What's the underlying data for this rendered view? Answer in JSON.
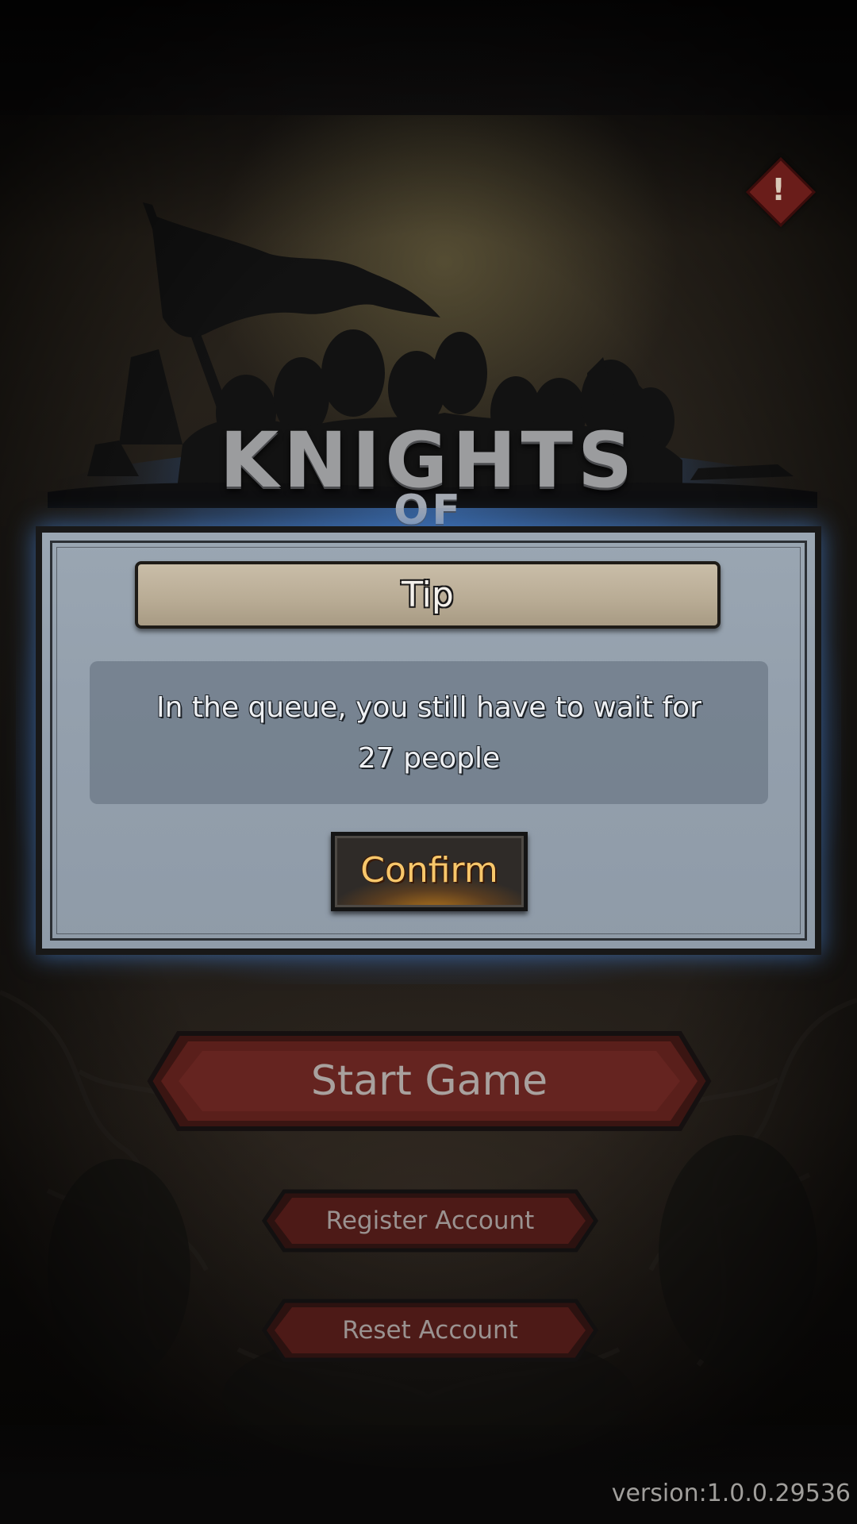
{
  "logo": {
    "title": "KNIGHTS",
    "subtitle": "OF"
  },
  "notice": {
    "icon": "exclamation-icon",
    "glyph": "!"
  },
  "dialog": {
    "title": "Tip",
    "message_line1": "In the queue, you still have to wait for",
    "message_line2": "27 people",
    "confirm_label": "Confirm"
  },
  "menu": {
    "start_label": "Start Game",
    "register_label": "Register Account",
    "reset_label": "Reset Account"
  },
  "footer": {
    "version": "version:1.0.0.29536"
  },
  "colors": {
    "dialog_glow": "#5a96dc",
    "menu_button": "#5a1e1b",
    "confirm_text": "#f7c76b"
  }
}
